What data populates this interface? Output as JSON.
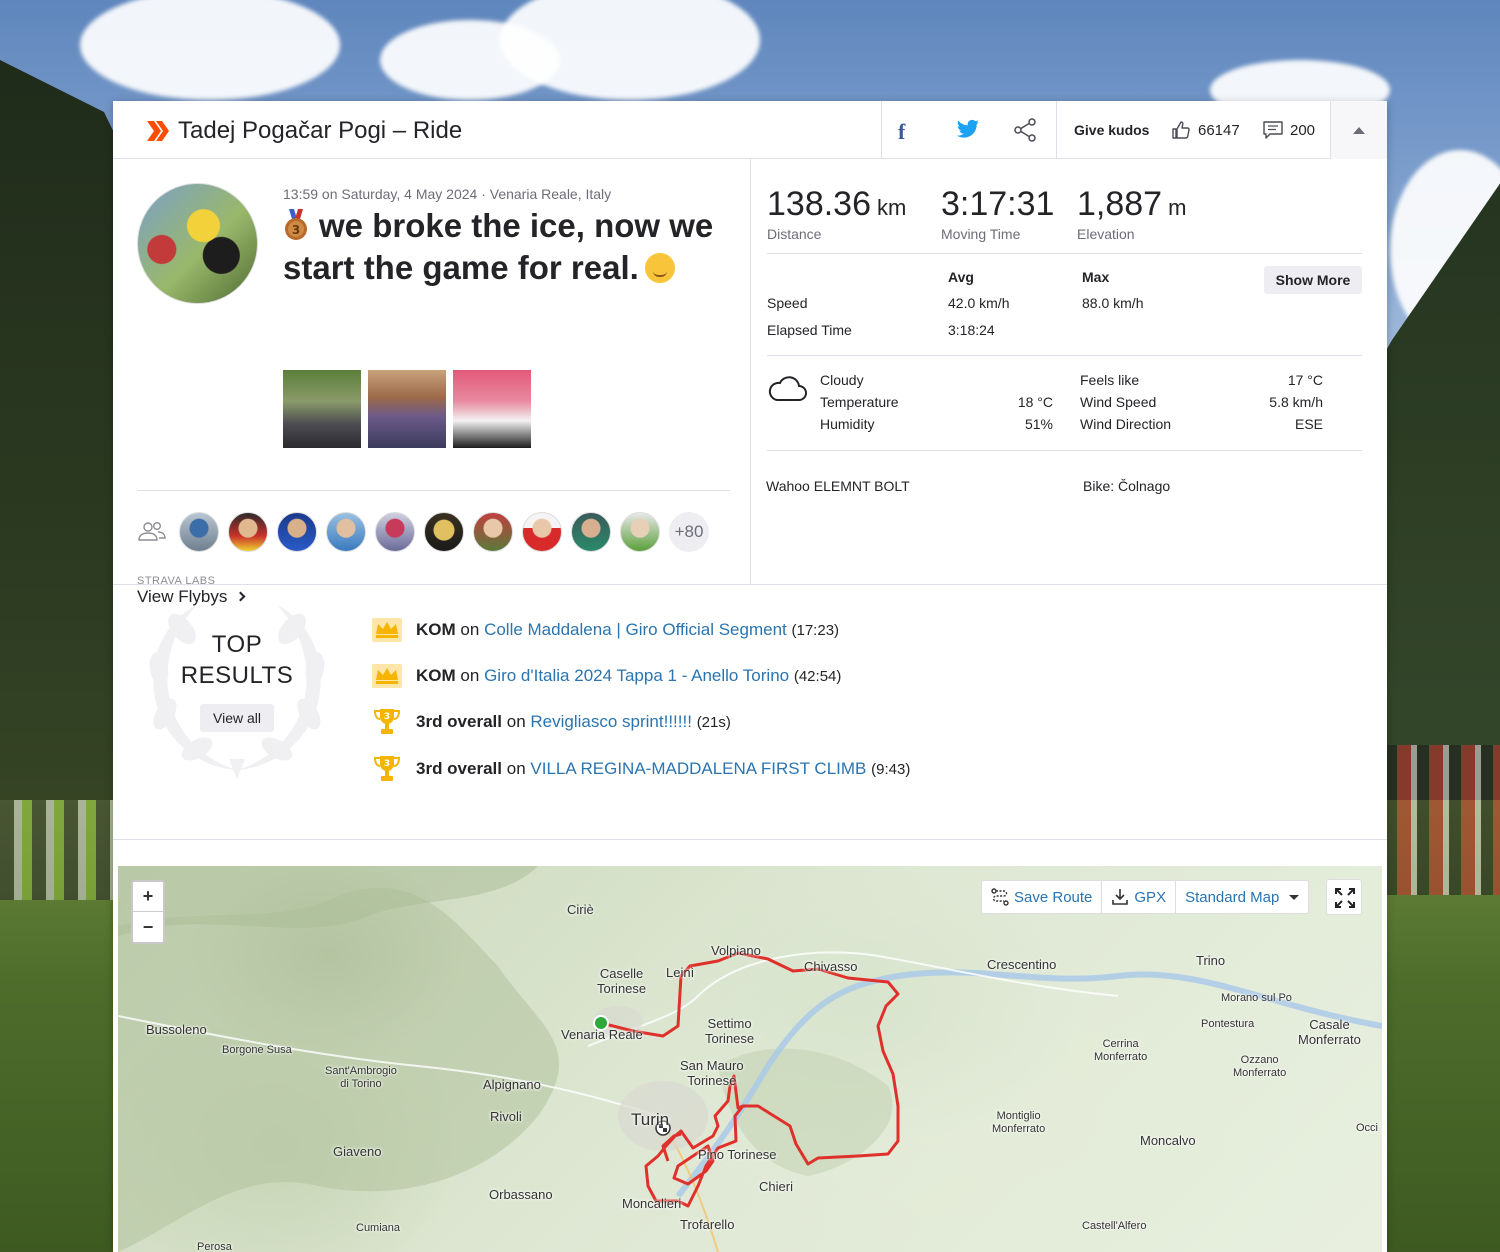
{
  "header": {
    "title": "Tadej Pogačar Pogi – Ride",
    "facebook_icon": "f",
    "give_kudos_label": "Give kudos",
    "kudos_count": "66147",
    "comment_count": "200"
  },
  "activity": {
    "meta": "13:59 on Saturday, 4 May 2024 · Venaria Reale, Italy",
    "title": "we broke the ice, now we start the game for real.",
    "photos_count": 3,
    "athletes_more": "+80",
    "labs_label": "STRAVA LABS",
    "flybys_label": "View Flybys"
  },
  "stats": {
    "distance": {
      "value": "138.36",
      "unit": "km",
      "label": "Distance"
    },
    "moving_time": {
      "value": "3:17:31",
      "label": "Moving Time"
    },
    "elevation": {
      "value": "1,887",
      "unit": "m",
      "label": "Elevation"
    },
    "avg_header": "Avg",
    "max_header": "Max",
    "show_more": "Show More",
    "speed_label": "Speed",
    "speed_avg": "42.0 km/h",
    "speed_max": "88.0 km/h",
    "elapsed_label": "Elapsed Time",
    "elapsed_avg": "3:18:24"
  },
  "weather": {
    "condition": "Cloudy",
    "temperature_label": "Temperature",
    "temperature": "18 °C",
    "humidity_label": "Humidity",
    "humidity": "51%",
    "feels_like_label": "Feels like",
    "feels_like": "17 °C",
    "wind_speed_label": "Wind Speed",
    "wind_speed": "5.8 km/h",
    "wind_direction_label": "Wind Direction",
    "wind_direction": "ESE"
  },
  "device": {
    "device": "Wahoo ELEMNT BOLT",
    "bike": "Bike: Čolnago"
  },
  "top_results": {
    "title_line1": "TOP",
    "title_line2": "RESULTS",
    "view_all": "View all",
    "items": [
      {
        "icon": "crown-icon",
        "rank": "KOM",
        "on": "on",
        "segment": "Colle Maddalena | Giro Official Segment",
        "time": "(17:23)"
      },
      {
        "icon": "crown-icon",
        "rank": "KOM",
        "on": "on",
        "segment": "Giro d'Italia 2024 Tappa 1 - Anello Torino",
        "time": "(42:54)"
      },
      {
        "icon": "trophy-icon",
        "rank": "3rd overall",
        "on": "on",
        "segment": "Revigliasco sprint!!!!!!",
        "time": "(21s)"
      },
      {
        "icon": "trophy-icon",
        "rank": "3rd overall",
        "on": "on",
        "segment": "VILLA REGINA-MADDALENA FIRST CLIMB",
        "time": "(9:43)"
      }
    ]
  },
  "map": {
    "zoom_in": "+",
    "zoom_out": "−",
    "save_route": "Save Route",
    "gpx": "GPX",
    "map_type": "Standard Map",
    "route_color": "#e0302c",
    "start_color": "#2ea83b",
    "places": {
      "cirie": "Ciriè",
      "volpiano": "Volpiano",
      "leini": "Leinì",
      "caselle": "Caselle\nTorinese",
      "chivasso": "Chivasso",
      "crescentino": "Crescentino",
      "trino": "Trino",
      "morano": "Morano sul Po",
      "pontestura": "Pontestura",
      "casale": "Casale\nMonferrato",
      "bussoleno": "Bussoleno",
      "borgone": "Borgone Susa",
      "venaria": "Venaria Reale",
      "settimo": "Settimo\nTorinese",
      "cerrina": "Cerrina\nMonferrato",
      "ozzano": "Ozzano\nMonferrato",
      "santambrogio": "Sant'Ambrogio\ndi Torino",
      "alpignano": "Alpignano",
      "sanmauro": "San Mauro\nTorinese",
      "rivoli": "Rivoli",
      "turin": "Turin",
      "montiglio": "Montiglio\nMonferrato",
      "moncalvo": "Moncalvo",
      "occi": "Occi",
      "giaveno": "Giaveno",
      "pino": "Pino Torinese",
      "chieri": "Chieri",
      "orbassano": "Orbassano",
      "moncalieri": "Moncalieri",
      "trofarello": "Trofarello",
      "cumiana": "Cumiana",
      "castellalfero": "Castell'Alfero",
      "perosa": "Perosa"
    }
  }
}
